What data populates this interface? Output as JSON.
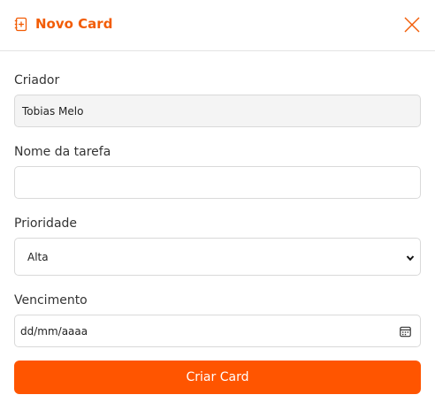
{
  "header": {
    "title": "Novo Card",
    "icon": "add-note-icon",
    "close_icon": "close-icon",
    "accent_color": "#f25c05"
  },
  "form": {
    "creator": {
      "label": "Criador",
      "value": "Tobias Melo"
    },
    "task_name": {
      "label": "Nome da tarefa",
      "value": "",
      "placeholder": ""
    },
    "priority": {
      "label": "Prioridade",
      "selected": "Alta",
      "icon": "chevron-down-icon"
    },
    "due_date": {
      "label": "Vencimento",
      "value": "dd/mm/aaaa",
      "icon": "calendar-icon"
    },
    "submit_label": "Criar Card",
    "submit_color": "#ff5500"
  }
}
